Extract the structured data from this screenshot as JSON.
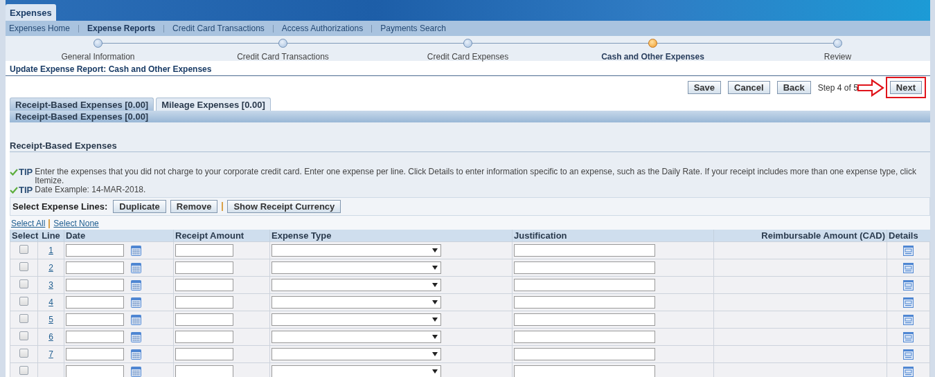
{
  "app_tab": {
    "label": "Expenses"
  },
  "nav": [
    {
      "label": "Expenses Home",
      "selected": false
    },
    {
      "label": "Expense Reports",
      "selected": true
    },
    {
      "label": "Credit Card Transactions",
      "selected": false
    },
    {
      "label": "Access Authorizations",
      "selected": false
    },
    {
      "label": "Payments Search",
      "selected": false
    }
  ],
  "train": [
    {
      "label": "General Information",
      "selected": false
    },
    {
      "label": "Credit Card Transactions",
      "selected": false
    },
    {
      "label": "Credit Card Expenses",
      "selected": false
    },
    {
      "label": "Cash and Other Expenses",
      "selected": true
    },
    {
      "label": "Review",
      "selected": false
    }
  ],
  "page_title": "Update Expense Report: Cash and Other Expenses",
  "actions": {
    "buttons": [
      "Save",
      "Cancel",
      "Back"
    ],
    "step": "Step 4 of 5",
    "next": "Next",
    "next_highlighted": true
  },
  "tabs": [
    {
      "label": "Receipt-Based Expenses [0.00]",
      "selected": true
    },
    {
      "label": "Mileage Expenses [0.00]",
      "selected": false
    }
  ],
  "subheader": "Receipt-Based Expenses [0.00]",
  "section_title": "Receipt-Based Expenses",
  "tips": [
    {
      "label": "TIP",
      "text": "Enter the expenses that you did not charge to your corporate credit card. Enter one expense per line. Click Details to enter information specific to an expense, such as the Daily Rate. If your receipt includes more than one expense type, click Itemize."
    },
    {
      "label": "TIP",
      "text": "Date Example: 14-MAR-2018."
    }
  ],
  "toolbar": {
    "label": "Select Expense Lines:",
    "buttons": [
      "Duplicate",
      "Remove"
    ],
    "extra_button": "Show Receipt Currency"
  },
  "selection_links": [
    "Select All",
    "Select None"
  ],
  "table": {
    "columns": [
      "Select",
      "Line",
      "Date",
      "Receipt Amount",
      "Expense Type",
      "Justification",
      "Reimbursable Amount (CAD)",
      "Details"
    ],
    "rows": [
      {
        "line": "1",
        "checked": false
      },
      {
        "line": "2",
        "checked": false
      },
      {
        "line": "3",
        "checked": false
      },
      {
        "line": "4",
        "checked": false
      },
      {
        "line": "5",
        "checked": false
      },
      {
        "line": "6",
        "checked": false
      },
      {
        "line": "7",
        "checked": false
      },
      {
        "checked": false
      }
    ]
  }
}
